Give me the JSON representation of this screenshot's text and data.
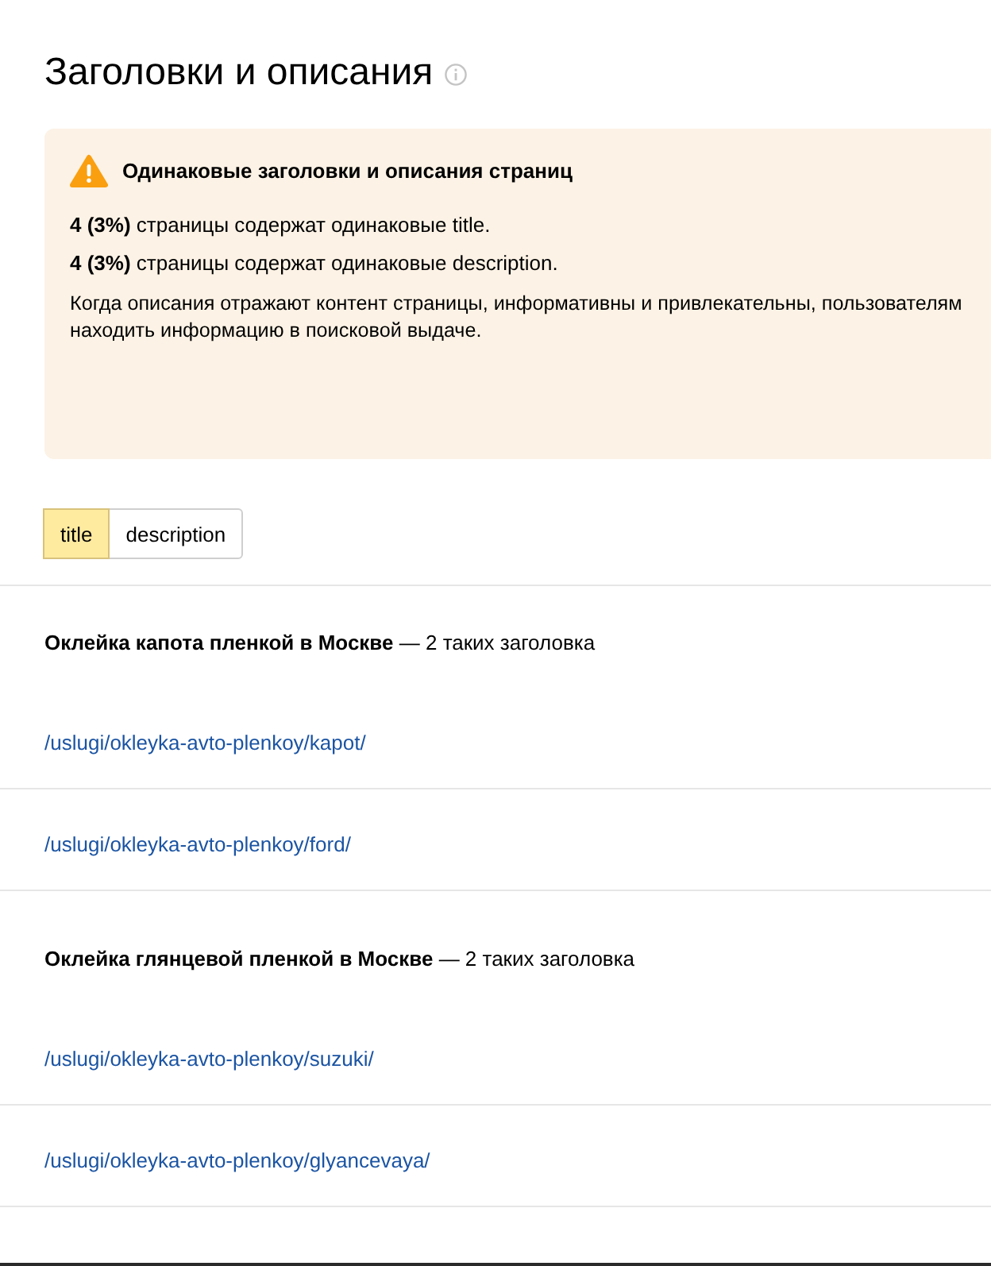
{
  "page": {
    "title": "Заголовки и описания"
  },
  "alert": {
    "heading": "Одинаковые заголовки и описания страниц",
    "stats": [
      "**4 (3%)** страницы содержат одинаковые title.",
      "**4 (3%)** страницы содержат одинаковые description."
    ],
    "note_lines": [
      "Когда описания отражают контент страницы, информативны и привлекательны, пользователям",
      "находить информацию в поисковой выдаче."
    ]
  },
  "tabs": [
    {
      "label": "title",
      "selected": true
    },
    {
      "label": "description",
      "selected": false
    }
  ],
  "groups": [
    {
      "heading": "**Оклейка капота пленкой в Москве** — 2 таких заголовка",
      "urls": [
        "/uslugi/okleyka-avto-plenkoy/kapot/",
        "/uslugi/okleyka-avto-plenkoy/ford/"
      ]
    },
    {
      "heading": "**Оклейка глянцевой пленкой в Москве** — 2 таких заголовка",
      "urls": [
        "/uslugi/okleyka-avto-plenkoy/suzuki/",
        "/uslugi/okleyka-avto-plenkoy/glyancevaya/"
      ]
    }
  ]
}
